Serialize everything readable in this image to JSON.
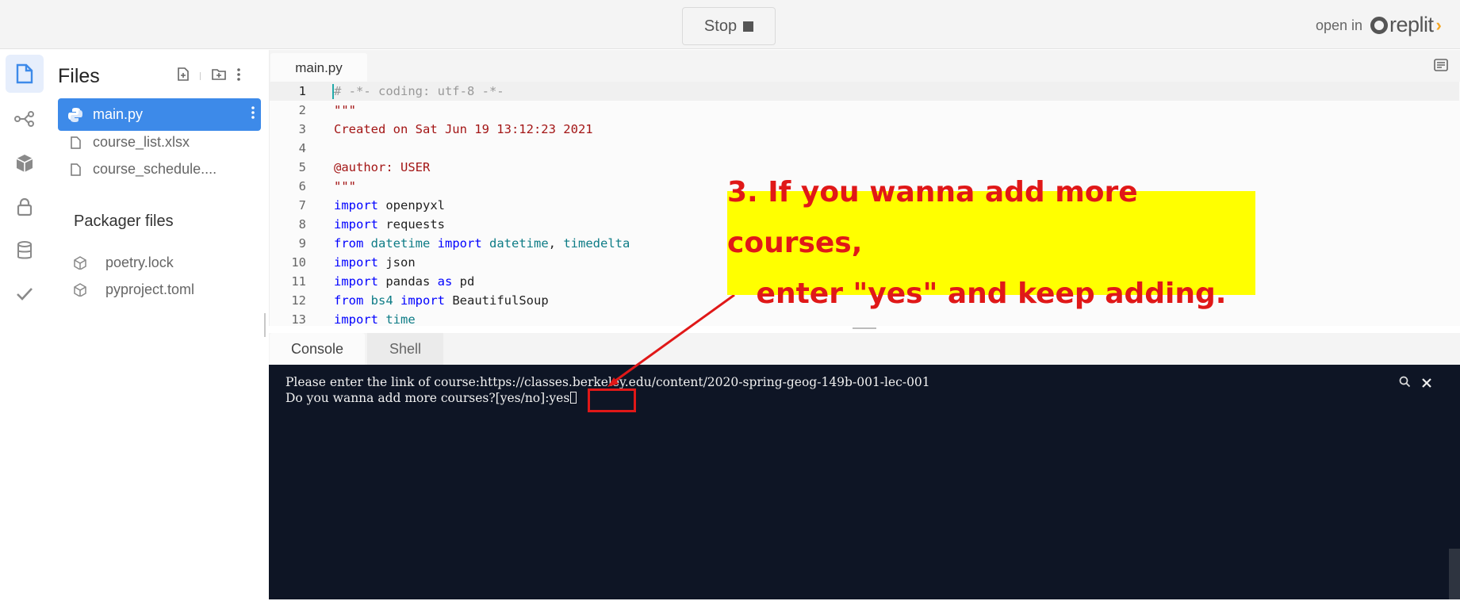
{
  "topbar": {
    "stop_label": "Stop",
    "open_in_label": "open in",
    "brand_name": "replit"
  },
  "rail": {
    "icons": [
      "file-icon",
      "version-control-icon",
      "packages-icon",
      "secrets-lock-icon",
      "database-icon",
      "unit-tests-check-icon"
    ]
  },
  "files": {
    "title": "Files",
    "items": [
      {
        "name": "main.py",
        "icon": "python-icon",
        "active": true
      },
      {
        "name": "course_list.xlsx",
        "icon": "file-icon",
        "active": false
      },
      {
        "name": "course_schedule....",
        "icon": "file-icon",
        "active": false
      }
    ],
    "packager_title": "Packager files",
    "packager_items": [
      {
        "name": "poetry.lock",
        "icon": "package-icon"
      },
      {
        "name": "pyproject.toml",
        "icon": "package-icon"
      }
    ]
  },
  "editor": {
    "tab_label": "main.py",
    "lines": [
      {
        "n": "1",
        "text": "# -*- coding: utf-8 -*-"
      },
      {
        "n": "2",
        "text": "\"\"\""
      },
      {
        "n": "3",
        "text": "Created on Sat Jun 19 13:12:23 2021"
      },
      {
        "n": "4",
        "text": ""
      },
      {
        "n": "5",
        "text": "@author: USER"
      },
      {
        "n": "6",
        "text": "\"\"\""
      },
      {
        "n": "7",
        "text": "import openpyxl"
      },
      {
        "n": "8",
        "text": "import requests"
      },
      {
        "n": "9",
        "text": "from datetime import datetime, timedelta"
      },
      {
        "n": "10",
        "text": "import json"
      },
      {
        "n": "11",
        "text": "import pandas as pd"
      },
      {
        "n": "12",
        "text": "from bs4 import BeautifulSoup"
      },
      {
        "n": "13",
        "text": "import time"
      }
    ]
  },
  "console": {
    "tabs": [
      "Console",
      "Shell"
    ],
    "lines": [
      "Please enter the link of course:https://classes.berkeley.edu/content/2020-spring-geog-149b-001-lec-001",
      "Do you wanna add more courses?[yes/no]:yes"
    ]
  },
  "annotation": {
    "line1": "3. If you wanna add more courses,",
    "line2": "enter \"yes\" and keep adding.",
    "color": "#e01818",
    "background": "#ffff00"
  }
}
